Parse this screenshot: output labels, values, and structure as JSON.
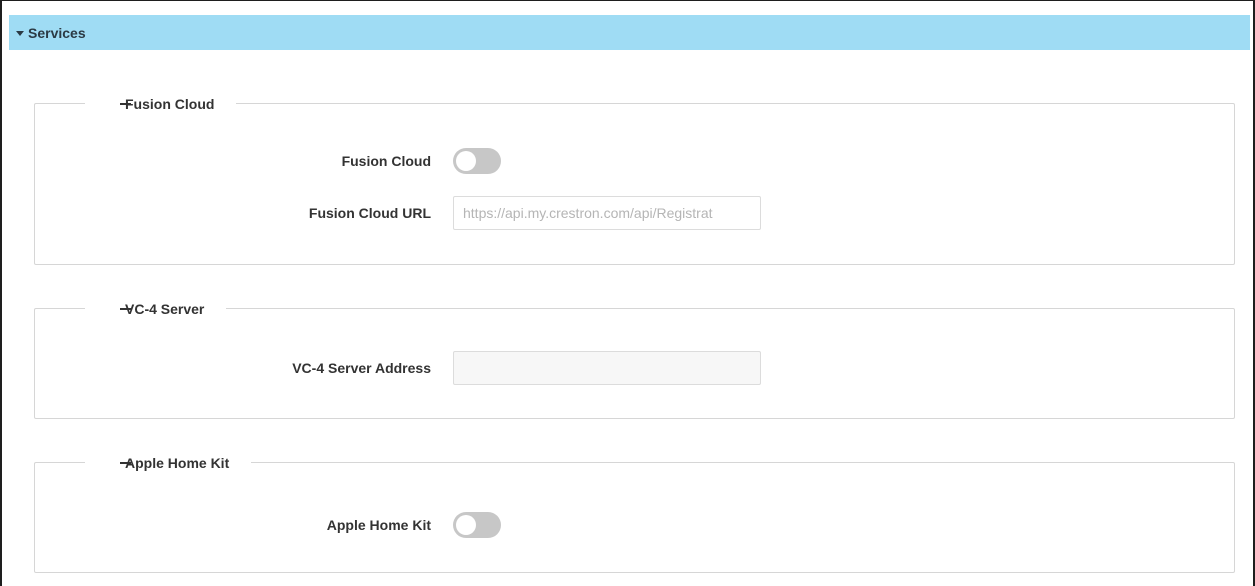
{
  "panel": {
    "title": "Services"
  },
  "sections": {
    "fusion_cloud": {
      "legend": "Fusion Cloud",
      "toggle_label": "Fusion Cloud",
      "toggle_state": "off",
      "url_label": "Fusion Cloud URL",
      "url_placeholder": "https://api.my.crestron.com/api/Registrat",
      "url_value": ""
    },
    "vc4_server": {
      "legend": "VC-4 Server",
      "address_label": "VC-4 Server Address",
      "address_value": ""
    },
    "apple_home_kit": {
      "legend": "Apple Home Kit",
      "toggle_label": "Apple Home Kit",
      "toggle_state": "off"
    }
  },
  "colors": {
    "header_background": "#9fdcf4",
    "toggle_off": "#c7c7c7",
    "border": "#d6d6d6"
  },
  "icons": {
    "header_caret": "caret-down-icon",
    "section_collapse": "minus-icon"
  }
}
